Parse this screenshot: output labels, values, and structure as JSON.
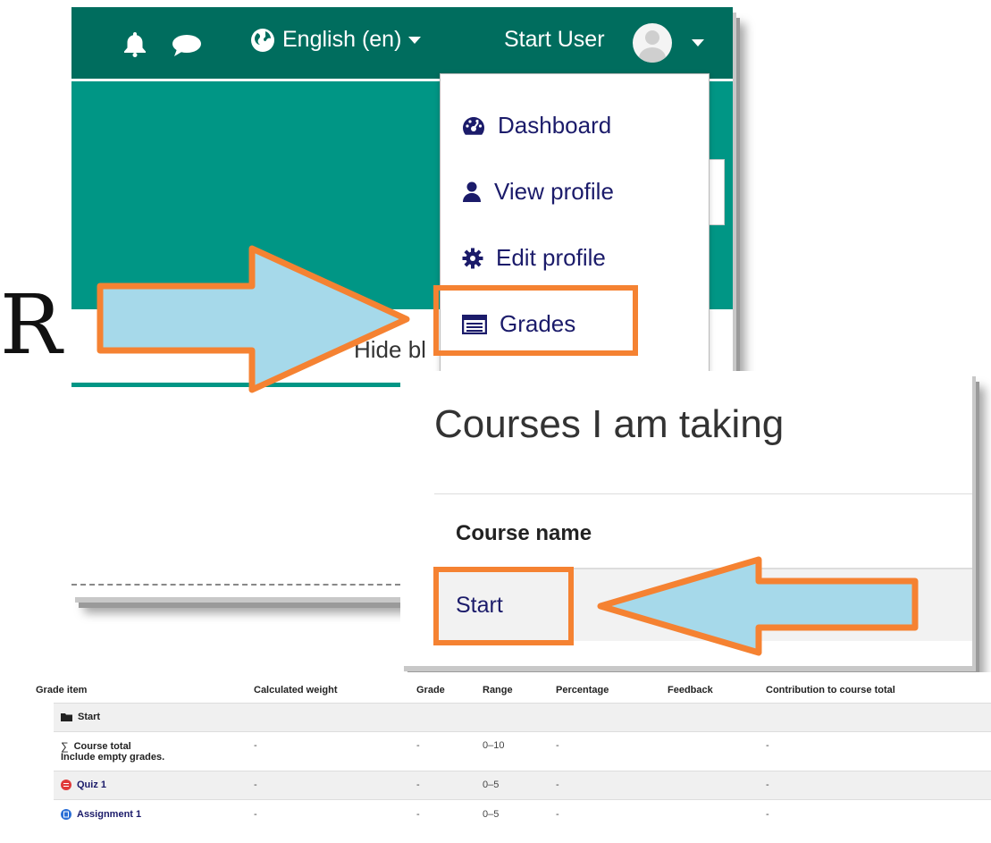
{
  "cropped_letter": "R",
  "navbar": {
    "language": "English (en)",
    "user_name": "Start User"
  },
  "user_menu": {
    "items": [
      {
        "label": "Dashboard",
        "icon": "dashboard-icon"
      },
      {
        "label": "View profile",
        "icon": "user-icon"
      },
      {
        "label": "Edit profile",
        "icon": "cog-icon"
      },
      {
        "label": "Grades",
        "icon": "table-icon"
      }
    ]
  },
  "partial_text": "Hide bl",
  "courses": {
    "title": "Courses I am taking",
    "column": "Course name",
    "rows": [
      "Start"
    ]
  },
  "grades_table": {
    "headers": [
      "Grade item",
      "Calculated weight",
      "Grade",
      "Range",
      "Percentage",
      "Feedback",
      "Contribution to course total"
    ],
    "category": "Start",
    "rows": [
      {
        "item": "Course total",
        "sub": "Include empty grades.",
        "weight": "-",
        "grade": "-",
        "range": "0–10",
        "percentage": "-",
        "feedback": "",
        "contribution": "-"
      },
      {
        "item": "Quiz 1",
        "weight": "-",
        "grade": "-",
        "range": "0–5",
        "percentage": "-",
        "feedback": "",
        "contribution": "-"
      },
      {
        "item": "Assignment 1",
        "weight": "-",
        "grade": "-",
        "range": "0–5",
        "percentage": "-",
        "feedback": "",
        "contribution": "-"
      }
    ]
  },
  "colors": {
    "navbar": "#006d5e",
    "banner": "#009685",
    "link": "#1b1b6a",
    "highlight": "#f58232",
    "arrow_fill": "#a6d9ea"
  }
}
